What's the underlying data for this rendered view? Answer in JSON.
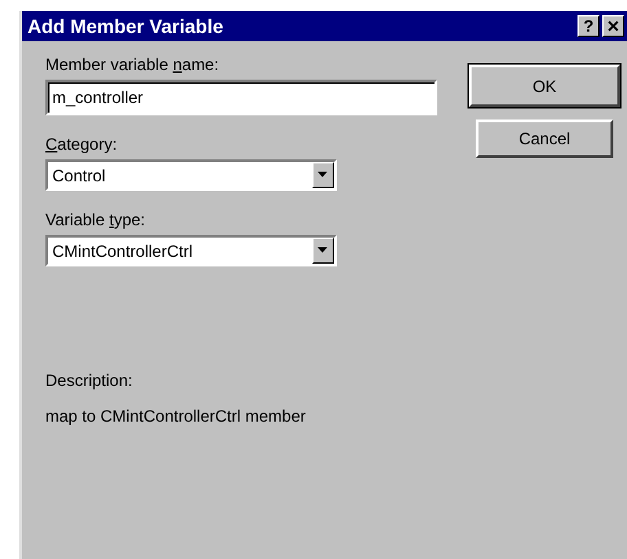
{
  "window": {
    "title": "Add Member Variable",
    "title_buttons": [
      {
        "kind": "help",
        "label": "?"
      },
      {
        "kind": "close",
        "label": "×"
      }
    ]
  },
  "fields": [
    {
      "kind": "text",
      "label_before": "Member variable ",
      "label_key": "n",
      "label_after": "ame:",
      "value": "m_controller"
    },
    {
      "kind": "combo",
      "label_key": "C",
      "label_after": "ategory:",
      "value": "Control"
    },
    {
      "kind": "combo",
      "label_before": "Variable ",
      "label_key": "t",
      "label_after": "ype:",
      "value": "CMintControllerCtrl"
    }
  ],
  "buttons": [
    {
      "label": "OK",
      "default": true
    },
    {
      "label": "Cancel",
      "default": false
    }
  ],
  "description": {
    "label": "Description:",
    "text": "map to CMintControllerCtrl member"
  }
}
